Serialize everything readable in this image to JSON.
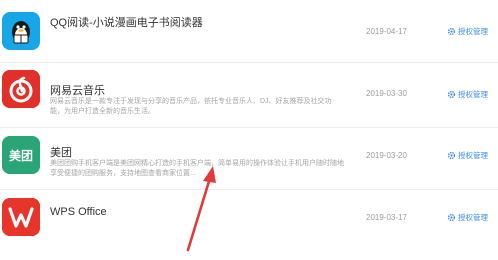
{
  "apps": [
    {
      "name": "QQ阅读-小说漫画电子书阅读器",
      "description": [
        "",
        ""
      ],
      "date": "2019-04-17",
      "action": "授权管理",
      "icon": "qq-reader-penguin-icon"
    },
    {
      "name": "网易云音乐",
      "description": [
        "网易云音乐是一款专注于发现与分享的音乐产品，依托专业音乐人、DJ、好友推荐及社交功",
        "能，为用户打造全新的音乐生活。"
      ],
      "date": "2019-03-30",
      "action": "授权管理",
      "icon": "netease-music-icon"
    },
    {
      "name": "美团",
      "description": [
        "美团团购手机客户端是美团网精心打造的手机客户端，简单易用的操作体验让手机用户随时随地",
        "享受便捷的团购服务，支持地图查看商家位置..."
      ],
      "date": "2019-03-20",
      "action": "授权管理",
      "icon": "meituan-icon"
    },
    {
      "name": "WPS Office",
      "description": [
        "",
        ""
      ],
      "date": "2019-03-17",
      "action": "授权管理",
      "icon": "wps-office-icon"
    }
  ],
  "colors": {
    "link": "#3a8ee6",
    "arrow": "#e03a3a",
    "netease": "#e1302a",
    "meituan": "#2aa577",
    "wps": "#e8352c",
    "qq": "#17a6e8"
  }
}
